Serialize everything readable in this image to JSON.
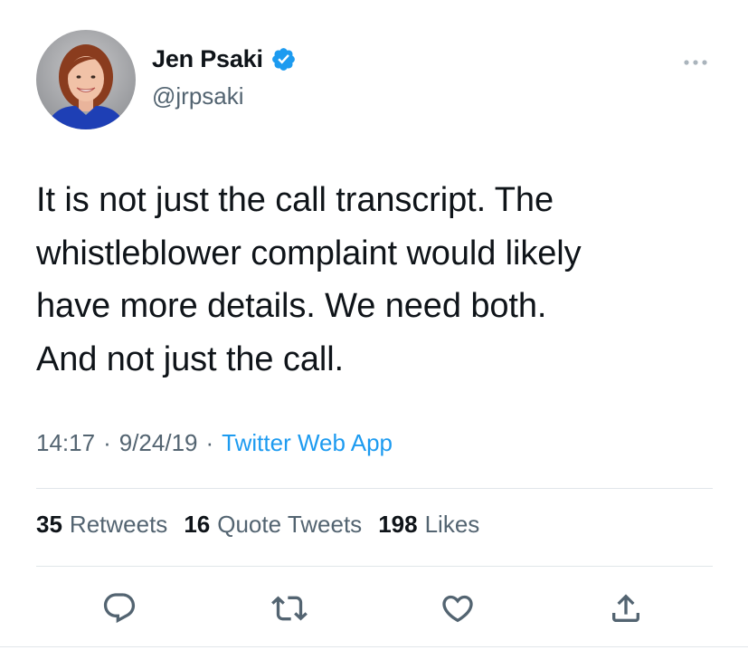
{
  "tweet": {
    "author": {
      "display_name": "Jen Psaki",
      "handle": "@jrpsaki",
      "verified": true,
      "avatar_icon": "avatar-photo"
    },
    "text": "It is not just the call transcript.  The\nwhistleblower complaint would likely\nhave more details.  We need both.\nAnd not just the call.",
    "meta": {
      "time": "14:17",
      "separator": "·",
      "date": "9/24/19",
      "source": "Twitter Web App"
    },
    "stats": {
      "retweets": {
        "count": "35",
        "label": "Retweets"
      },
      "quote_tweets": {
        "count": "16",
        "label": "Quote Tweets"
      },
      "likes": {
        "count": "198",
        "label": "Likes"
      }
    },
    "actions": [
      {
        "name": "reply",
        "icon": "reply-icon"
      },
      {
        "name": "retweet",
        "icon": "retweet-icon"
      },
      {
        "name": "like",
        "icon": "heart-icon"
      },
      {
        "name": "share",
        "icon": "share-icon"
      }
    ],
    "colors": {
      "text": "#0f1419",
      "secondary": "#536471",
      "accent": "#1d9bf0",
      "divider": "#e1e6ea"
    }
  }
}
